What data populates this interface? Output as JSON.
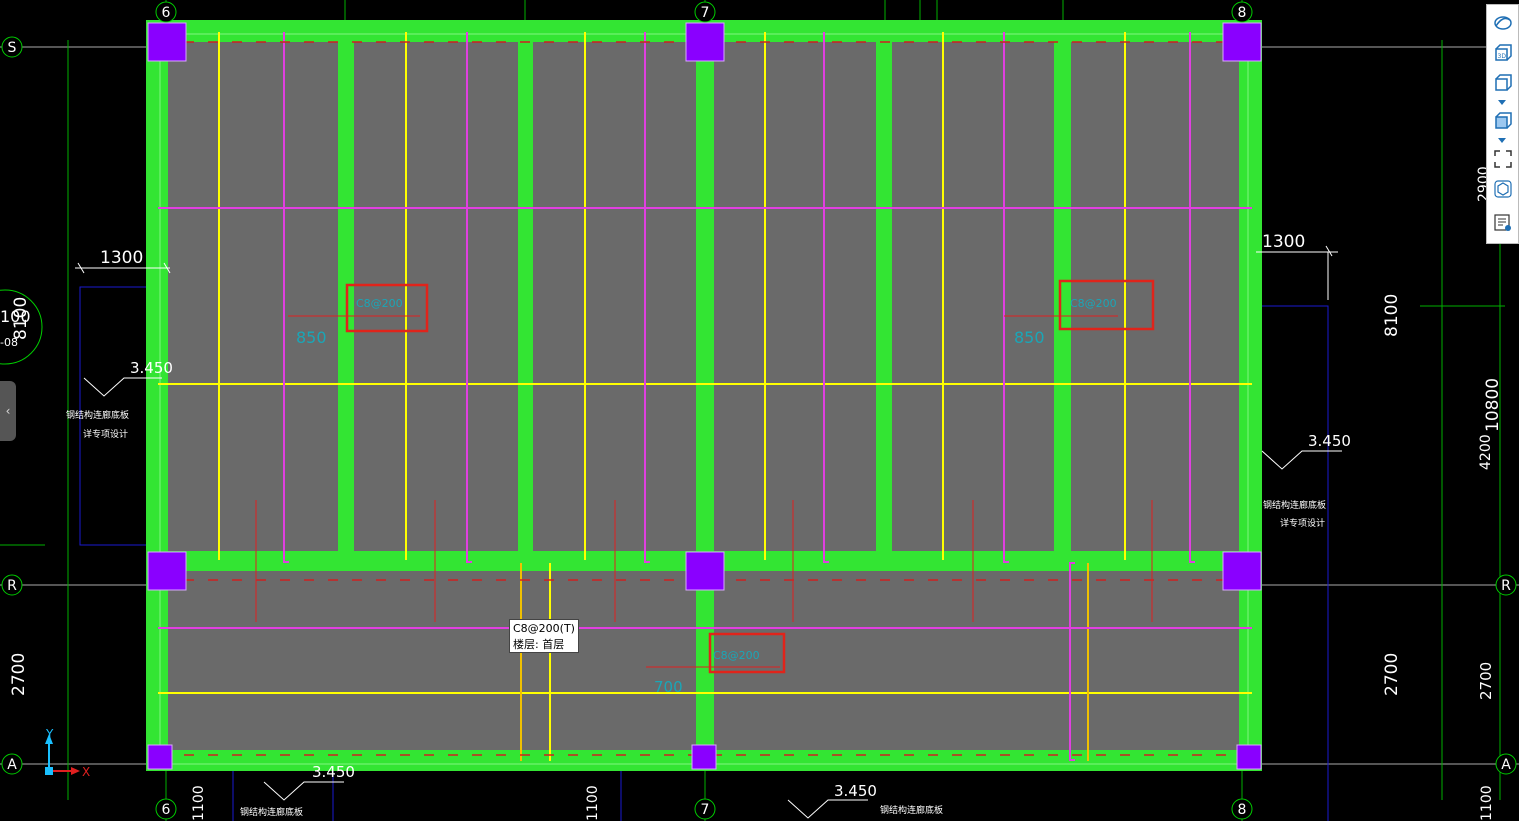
{
  "axes": {
    "col_6": "6",
    "col_7": "7",
    "col_8": "8",
    "row_s": "S",
    "row_r": "R",
    "row_a": "A"
  },
  "dimensions": {
    "d1300_left": "1300",
    "d1300_right": "1300",
    "d8100_left": "8100",
    "d8100_right": "8100",
    "d2700_left": "2700",
    "d2700_right_a": "2700",
    "d2700_right_b": "2700",
    "d10800": "10800",
    "d4200": "4200",
    "d2900": "2900",
    "d1100_a": "1100",
    "d1100_b": "1100",
    "d1100_c": "1100",
    "circle_top": "100",
    "circle_mid": "8100",
    "circle_bot": "-08"
  },
  "elevations": {
    "el_left": "3.450",
    "el_right": "3.450",
    "el_bottom_left": "3.450",
    "el_bottom_mid": "3.450"
  },
  "notes": {
    "left_line1": "钢结构连廊底板",
    "left_line2": "详专项设计",
    "right_line1": "钢结构连廊底板",
    "right_line2": "详专项设计",
    "bottom_left": "钢结构连廊底板",
    "bottom_mid": "钢结构连廊底板"
  },
  "rebar_labels": {
    "r850_left": "850",
    "r850_right": "850",
    "r700": "700"
  },
  "tooltip": {
    "line1": "C8@200(T)",
    "line2": "楼层: 首层"
  },
  "ucs": {
    "x_label": "X",
    "y_label": "Y"
  },
  "toolbar": {
    "btn_3d_label": "3D"
  },
  "colors": {
    "beam_green": "#33e533",
    "slab_gray": "#6a6a6a",
    "column_purple": "#8a00ff",
    "rebar_yellow": "#ffff00",
    "rebar_magenta": "#e040e0",
    "highlight_red": "#e0241b",
    "axis_green": "#00cc00",
    "dim_white": "#ffffff",
    "label_cyan": "#1aa6b7"
  }
}
